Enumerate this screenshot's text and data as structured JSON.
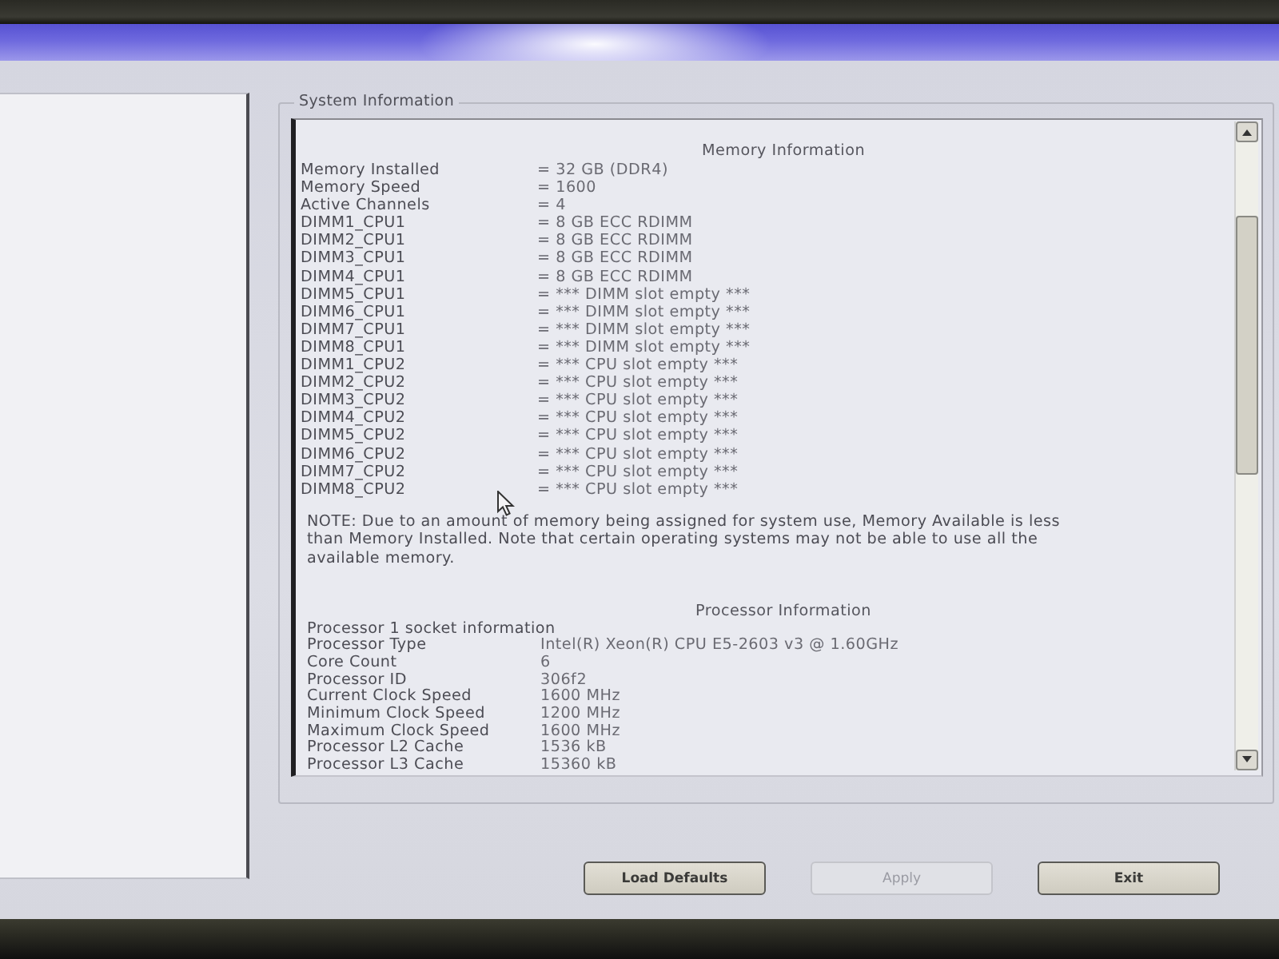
{
  "system_information": {
    "title": "System Information",
    "memory": {
      "heading": "Memory Information",
      "rows": [
        {
          "label": "Memory Installed",
          "value": "= 32 GB (DDR4)"
        },
        {
          "label": "Memory Speed",
          "value": "= 1600"
        },
        {
          "label": "Active Channels",
          "value": "= 4"
        },
        {
          "label": "DIMM1_CPU1",
          "value": "= 8 GB ECC RDIMM"
        },
        {
          "label": "DIMM2_CPU1",
          "value": "= 8 GB ECC RDIMM"
        },
        {
          "label": "DIMM3_CPU1",
          "value": "= 8 GB ECC RDIMM"
        },
        {
          "label": "DIMM4_CPU1",
          "value": "= 8 GB ECC RDIMM"
        },
        {
          "label": "DIMM5_CPU1",
          "value": "= *** DIMM slot empty ***"
        },
        {
          "label": "DIMM6_CPU1",
          "value": "= *** DIMM slot empty ***"
        },
        {
          "label": "DIMM7_CPU1",
          "value": "= *** DIMM slot empty ***"
        },
        {
          "label": "DIMM8_CPU1",
          "value": "= *** DIMM slot empty ***"
        },
        {
          "label": "DIMM1_CPU2",
          "value": "= *** CPU slot empty ***"
        },
        {
          "label": "DIMM2_CPU2",
          "value": "= *** CPU slot empty ***"
        },
        {
          "label": "DIMM3_CPU2",
          "value": "= *** CPU slot empty ***"
        },
        {
          "label": "DIMM4_CPU2",
          "value": "= *** CPU slot empty ***"
        },
        {
          "label": "DIMM5_CPU2",
          "value": "= *** CPU slot empty ***"
        },
        {
          "label": "DIMM6_CPU2",
          "value": "= *** CPU slot empty ***"
        },
        {
          "label": "DIMM7_CPU2",
          "value": "= *** CPU slot empty ***"
        },
        {
          "label": "DIMM8_CPU2",
          "value": "= *** CPU slot empty ***"
        }
      ]
    },
    "note": "NOTE: Due to an amount of memory being assigned for system use, Memory Available is less than Memory Installed. Note that certain operating systems may not be able to use all the available memory.",
    "processor": {
      "heading": "Processor Information",
      "subheading": "Processor 1 socket information",
      "rows": [
        {
          "label": "Processor Type",
          "value": "Intel(R) Xeon(R) CPU E5-2603 v3 @ 1.60GHz"
        },
        {
          "label": "Core Count",
          "value": "6"
        },
        {
          "label": "Processor ID",
          "value": "306f2"
        },
        {
          "label": "Current Clock Speed",
          "value": "1600 MHz"
        },
        {
          "label": "Minimum Clock Speed",
          "value": "1200 MHz"
        },
        {
          "label": "Maximum Clock Speed",
          "value": "1600 MHz"
        },
        {
          "label": "Processor L2 Cache",
          "value": "1536 kB"
        },
        {
          "label": "Processor L3 Cache",
          "value": "15360 kB"
        }
      ]
    }
  },
  "buttons": [
    {
      "label": "Load Defaults",
      "disabled": false
    },
    {
      "label": "Apply",
      "disabled": true
    },
    {
      "label": "Exit",
      "disabled": false
    }
  ]
}
